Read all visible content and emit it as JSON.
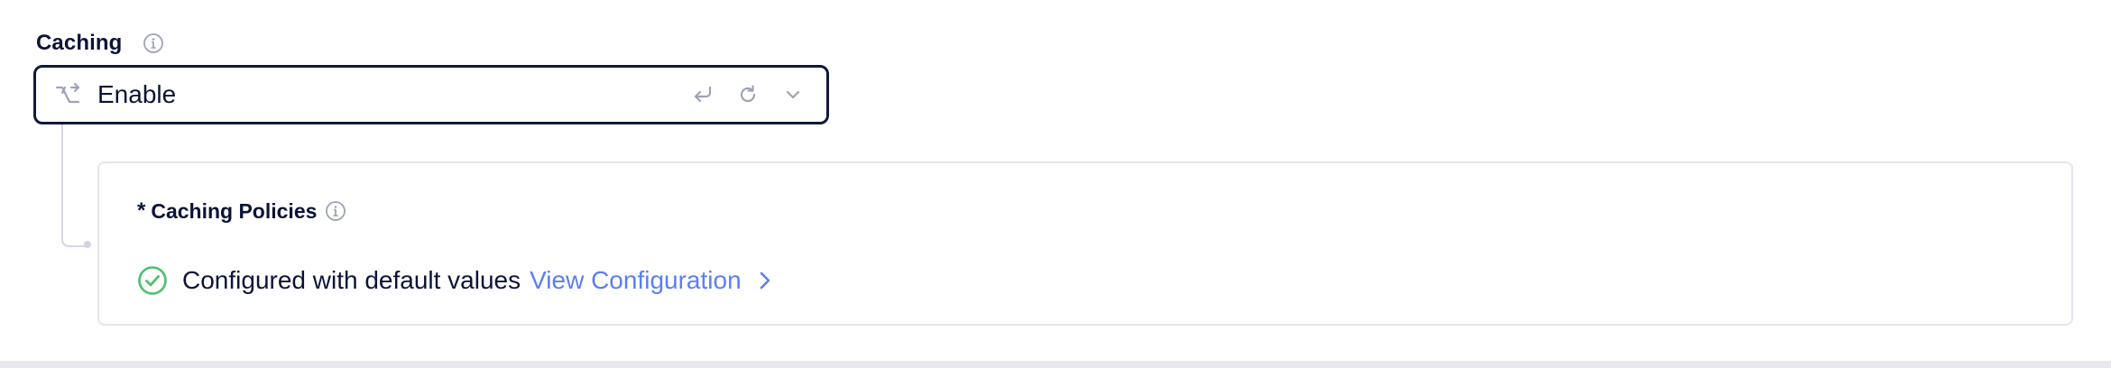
{
  "section": {
    "title": "Caching",
    "info_icon": "info-icon"
  },
  "select": {
    "lead_icon": "branch-icon",
    "value": "Enable",
    "actions": [
      "undo-icon",
      "refresh-icon",
      "chevron-down-icon"
    ]
  },
  "policies": {
    "required_marker": "*",
    "label": "Caching Policies",
    "info_icon": "info-icon",
    "status_icon": "check-circle-icon",
    "status_text": "Configured with default values",
    "link_text": "View Configuration",
    "link_icon": "chevron-right-icon"
  },
  "colors": {
    "text_primary": "#0b1437",
    "border_focus": "#0f1a3a",
    "link": "#5b7ef5",
    "success": "#4cbf6b",
    "muted_icon": "#9ea3b5"
  }
}
